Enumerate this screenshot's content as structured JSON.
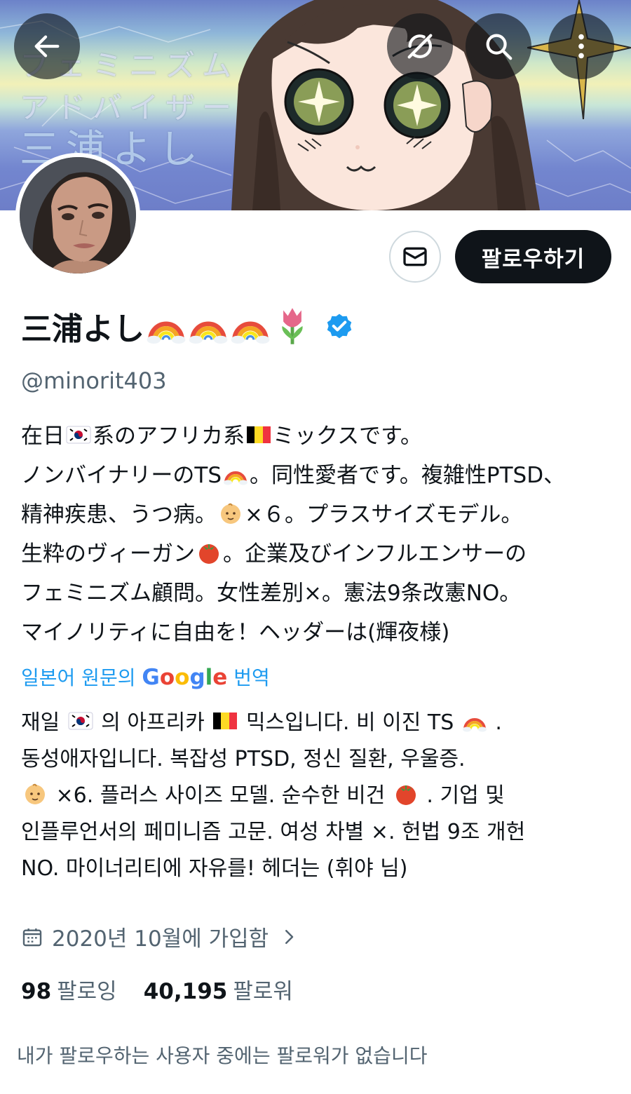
{
  "banner": {
    "text_lines": [
      "フェミニズム",
      "アドバイザー",
      "三浦よし"
    ]
  },
  "header": {
    "back_icon": "arrow-left-icon",
    "grok_icon": "slash-circle-icon",
    "search_icon": "search-icon",
    "more_icon": "more-vertical-icon"
  },
  "actions": {
    "message_icon": "envelope-icon",
    "follow_label": "팔로우하기"
  },
  "profile": {
    "name": "三浦よし",
    "name_emojis": [
      "rainbow",
      "rainbow",
      "rainbow",
      "tulip"
    ],
    "verified": true,
    "handle": "@minorit403"
  },
  "bio_ja": {
    "l1_a": "在日",
    "l1_b": "系のアフリカ系",
    "l1_c": "ミックスです。",
    "l2_a": "ノンバイナリーのTS",
    "l2_b": "。同性愛者です。複雑性PTSD、",
    "l3_a": "精神疾患、うつ病。",
    "l3_b": "×６。プラスサイズモデル。",
    "l4_a": "生粋のヴィーガン",
    "l4_b": "。企業及びインフルエンサーの",
    "l5": "フェミニズム顧問。女性差別×。憲法9条改憲NO。",
    "l6": "マイノリティに自由を！ヘッダーは(輝夜様)"
  },
  "translation": {
    "prefix": "일본어 원문의",
    "google": "Google",
    "suffix": "번역"
  },
  "bio_ko": {
    "l1_a": "재일",
    "l1_b": "의 아프리카",
    "l1_c": "믹스입니다. 비 이진 TS",
    "l1_d": ".",
    "l2": "동성애자입니다. 복잡성 PTSD, 정신 질환, 우울증.",
    "l3_a": "×6. 플러스 사이즈 모델. 순수한 비건",
    "l3_b": ". 기업 및",
    "l4": "인플루언서의 페미니즘 고문. 여성 차별 ×. 헌법 9조 개헌",
    "l5": "NO. 마이너리티에 자유를! 헤더는 (휘야 님)"
  },
  "joined": {
    "icon": "calendar-icon",
    "text": "2020년 10월에 가입함"
  },
  "stats": {
    "following_count": "98",
    "following_label": "팔로잉",
    "followers_count": "40,195",
    "followers_label": "팔로워"
  },
  "mutual_note": "내가 팔로우하는 사용자 중에는 팔로워가 없습니다",
  "colors": {
    "accent_blue": "#1d9bf0",
    "text_primary": "#0f1419",
    "text_secondary": "#536471",
    "follow_button_bg": "#0f1419"
  }
}
